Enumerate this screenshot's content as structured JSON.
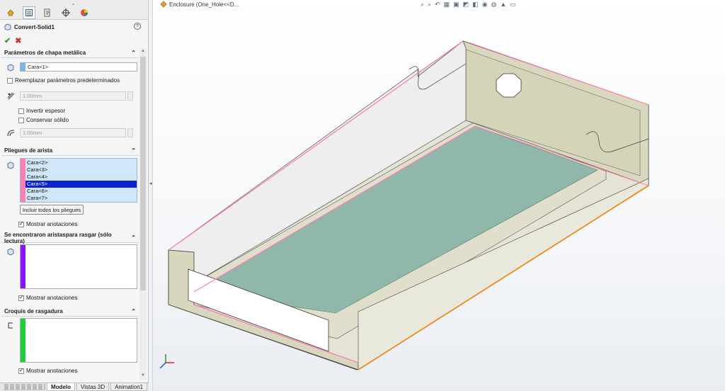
{
  "document": {
    "breadcrumb": "Enclosure  (One_Hole<<D..."
  },
  "property_manager": {
    "title": "Convert-Solid1",
    "tabs": [
      "feature-manager-icon",
      "property-manager-icon",
      "configuration-manager-icon",
      "dimxpert-icon",
      "display-manager-icon"
    ],
    "sections": {
      "sheet_metal": {
        "header": "Parámetros de chapa metálica",
        "face_value": "Cara<1>",
        "override_label": "Reemplazar parámetros predeterminados",
        "thickness": "1.00mm",
        "reverse_thickness_label": "Invertir espesor",
        "keep_solid_label": "Conservar sólido",
        "radius": "1.00mm"
      },
      "bend_edges": {
        "header": "Pliegues de arista",
        "items": [
          "Cara<2>",
          "Cara<3>",
          "Cara<4>",
          "Cara<5>",
          "Cara<6>",
          "Cara<7>"
        ],
        "selected_index": 3,
        "include_all_button": "Incluir todos los pliegues",
        "show_callouts_label": "Mostrar anotaciones",
        "accent_color": "#ff7fb2"
      },
      "rip_edges": {
        "header": "Se encontraron aristaspara rasgar (sólo lectura)",
        "show_callouts_label": "Mostrar anotaciones",
        "accent_color": "#8a13ff"
      },
      "rip_sketches": {
        "header": "Croquis de rasgadura",
        "show_callouts_label": "Mostrar anotaciones",
        "accent_color": "#1fcf3a"
      }
    }
  },
  "bottom_tabs": [
    "Modelo",
    "Vistas 3D",
    "Animation1"
  ],
  "colors": {
    "accent_blue": "#0b22cf",
    "selection_fill": "#cfe6fb",
    "model_body": "#e6e5d5",
    "model_floor": "#8fb8aa",
    "model_wall": "#d6d4b8",
    "bend_edge": "#ff7fb2",
    "rip_edge": "#f08a1e"
  }
}
